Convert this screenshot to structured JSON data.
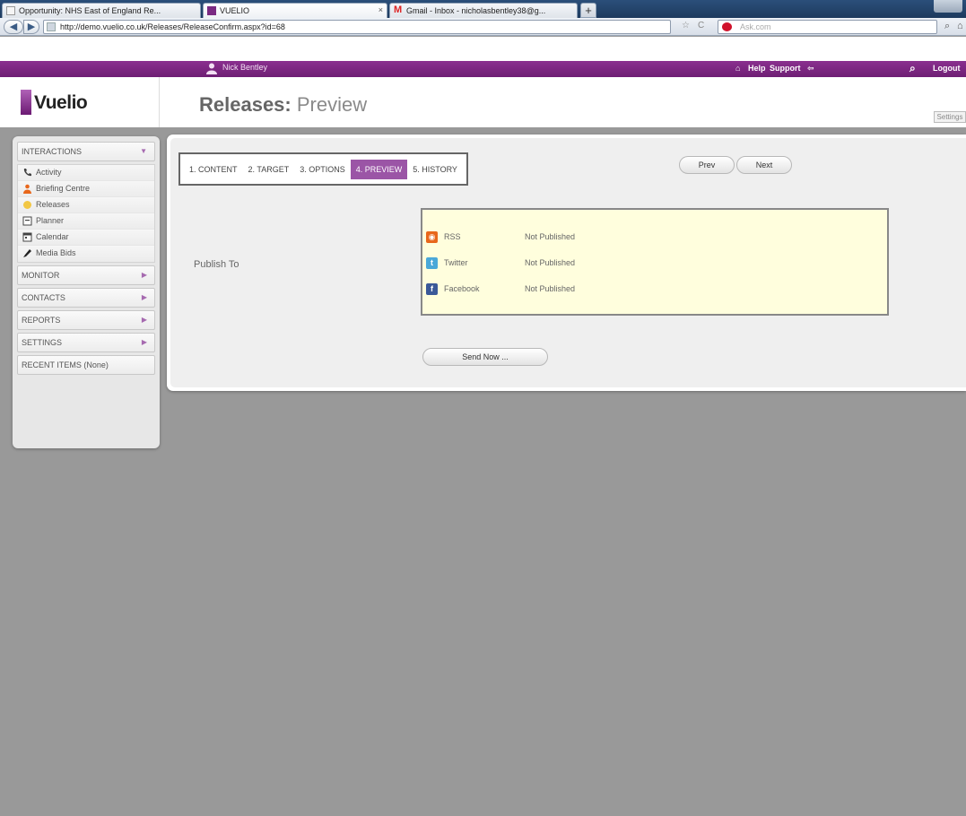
{
  "browser": {
    "tabs": [
      {
        "label": "Opportunity: NHS East of England Re...",
        "active": false
      },
      {
        "label": "VUELIO",
        "active": true
      },
      {
        "label": "Gmail - Inbox - nicholasbentley38@g...",
        "active": false
      }
    ],
    "new_tab_label": "+",
    "url": "http://demo.vuelio.co.uk/Releases/ReleaseConfirm.aspx?id=68",
    "search_placeholder": "Ask.com"
  },
  "topbar": {
    "user_name": "Nick Bentley",
    "help_label": "Help",
    "support_label": "Support",
    "logout_label": "Logout"
  },
  "header": {
    "logo_text": "Vuelio",
    "title_main": "Releases:",
    "title_sub": "Preview",
    "settings_label": "Settings"
  },
  "sidebar": {
    "interactions_label": "INTERACTIONS",
    "items": [
      {
        "label": "Activity",
        "icon": "phone-icon"
      },
      {
        "label": "Briefing Centre",
        "icon": "briefing-icon"
      },
      {
        "label": "Releases",
        "icon": "releases-icon"
      },
      {
        "label": "Planner",
        "icon": "planner-icon"
      },
      {
        "label": "Calendar",
        "icon": "calendar-icon"
      },
      {
        "label": "Media Bids",
        "icon": "pen-icon"
      }
    ],
    "sections": [
      {
        "label": "MONITOR"
      },
      {
        "label": "CONTACTS"
      },
      {
        "label": "REPORTS"
      },
      {
        "label": "SETTINGS"
      }
    ],
    "recent_label": "RECENT ITEMS (None)"
  },
  "wizard": {
    "steps": [
      {
        "label": "1. CONTENT",
        "active": false
      },
      {
        "label": "2. TARGET",
        "active": false
      },
      {
        "label": "3. OPTIONS",
        "active": false
      },
      {
        "label": "4. PREVIEW",
        "active": true
      },
      {
        "label": "5. HISTORY",
        "active": false
      }
    ],
    "prev_label": "Prev",
    "next_label": "Next"
  },
  "publish": {
    "label": "Publish To",
    "channels": [
      {
        "name": "RSS",
        "status": "Not Published",
        "color": "#e8671b"
      },
      {
        "name": "Twitter",
        "status": "Not Published",
        "color": "#4aa8d8"
      },
      {
        "name": "Facebook",
        "status": "Not Published",
        "color": "#3b5998"
      }
    ],
    "send_label": "Send Now ..."
  }
}
